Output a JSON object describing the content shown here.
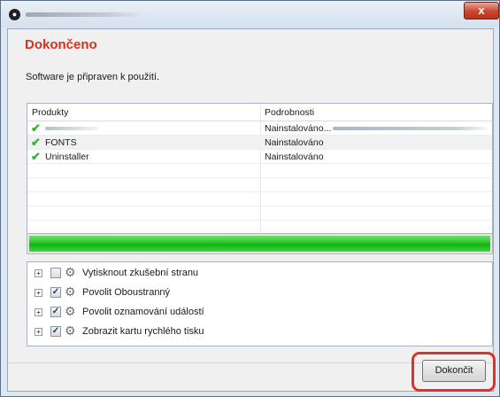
{
  "window": {
    "close_glyph": "x",
    "app_icon": "app-globe-icon"
  },
  "heading": "Dokončeno",
  "subtext": "Software je připraven k použití.",
  "table": {
    "columns": [
      "Produkty",
      "Podrobnosti"
    ],
    "rows": [
      {
        "name": "",
        "status": "Nainstalováno...",
        "icon": "check-icon"
      },
      {
        "name": "FONTS",
        "status": "Nainstalováno",
        "icon": "check-icon"
      },
      {
        "name": "Uninstaller",
        "status": "Nainstalováno",
        "icon": "check-icon"
      }
    ]
  },
  "progress": {
    "value": 1.0,
    "color": "#22c322"
  },
  "options": [
    {
      "label": "Vytisknout zkušební stranu",
      "checked": false,
      "icon": "gear-icon"
    },
    {
      "label": "Povolit Oboustranný",
      "checked": true,
      "icon": "gear-icon"
    },
    {
      "label": "Povolit oznamování událostí",
      "checked": true,
      "icon": "gear-icon"
    },
    {
      "label": "Zobrazit kartu rychlého tisku",
      "checked": true,
      "icon": "gear-icon"
    }
  ],
  "finish_button": "Dokončit",
  "colors": {
    "heading": "#d6321e",
    "highlight": "#e0302a",
    "check": "#2eb82e"
  }
}
